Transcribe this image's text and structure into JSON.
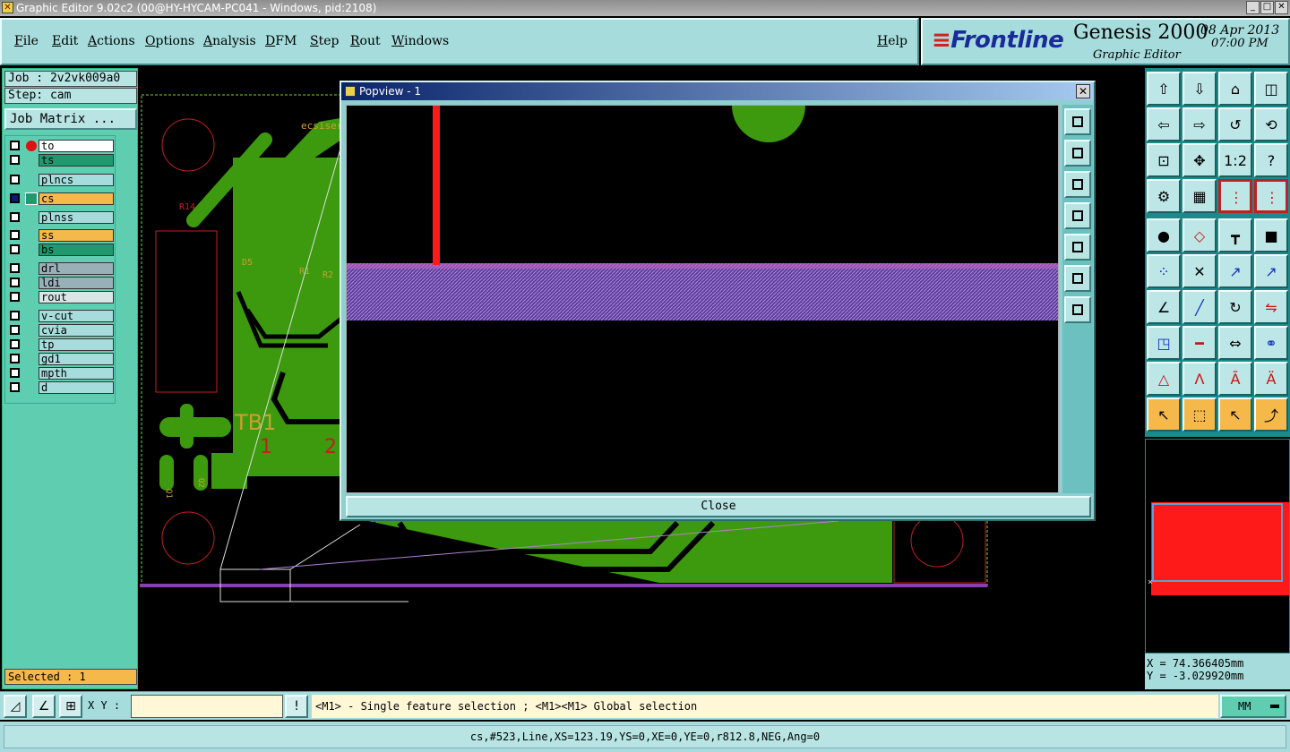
{
  "window": {
    "title": "Graphic Editor 9.02c2 (00@HY-HYCAM-PC041 - Windows, pid:2108)",
    "controls": [
      "_",
      "□",
      "✕"
    ]
  },
  "menu": [
    "File",
    "Edit",
    "Actions",
    "Options",
    "Analysis",
    "DFM",
    "Step",
    "Rout",
    "Windows"
  ],
  "help_label": "Help",
  "logo": {
    "brand": "Frontline",
    "product": "Genesis 2000",
    "subtitle": "Graphic Editor",
    "date": "08 Apr 2013",
    "time": "07:00 PM"
  },
  "job": {
    "job_label": "Job : 2v2vk009a0",
    "step_label": "Step: cam",
    "matrix_button": "Job Matrix ..."
  },
  "layers": [
    {
      "name": "to",
      "color": "#ffffff",
      "marker": "red-dot"
    },
    {
      "name": "ts",
      "color": "#1e9a6e",
      "marker": ""
    },
    {
      "name": "plncs",
      "color": "#a6dcdc",
      "marker": ""
    },
    {
      "name": "cs",
      "color": "#f5b84a",
      "marker": "work"
    },
    {
      "name": "plnss",
      "color": "#a6dcdc",
      "marker": ""
    },
    {
      "name": "ss",
      "color": "#f5b84a",
      "marker": ""
    },
    {
      "name": "bs",
      "color": "#1e9a6e",
      "marker": ""
    },
    {
      "name": "drl",
      "color": "#9ab0b8",
      "marker": ""
    },
    {
      "name": "ldi",
      "color": "#9ab0b8",
      "marker": ""
    },
    {
      "name": "rout",
      "color": "#d9e6e6",
      "marker": ""
    },
    {
      "name": "v-cut",
      "color": "#a6dcdc",
      "marker": ""
    },
    {
      "name": "cvia",
      "color": "#a6dcdc",
      "marker": ""
    },
    {
      "name": "tp",
      "color": "#a6dcdc",
      "marker": ""
    },
    {
      "name": "gd1",
      "color": "#a6dcdc",
      "marker": ""
    },
    {
      "name": "mpth",
      "color": "#a6dcdc",
      "marker": ""
    },
    {
      "name": "d",
      "color": "#a6dcdc",
      "marker": ""
    }
  ],
  "selected_label": "Selected : 1",
  "board_labels": {
    "r14": "R14",
    "d5": "D5",
    "r1": "R1",
    "r2": "R2",
    "tb1": "TB1",
    "tb1_pin1": "1",
    "tb1_pin2": "2",
    "silk": "ecsiser",
    "q1": "Q1",
    "q2": "Q2"
  },
  "popview": {
    "title": "Popview - 1",
    "close_label": "Close",
    "tools": [
      "zoom-window-icon",
      "pan-up-icon",
      "pan-down-icon",
      "pan-left-icon",
      "pan-right-icon",
      "zoom-in-icon",
      "zoom-out-icon"
    ]
  },
  "toolbox": [
    [
      "pan-up-icon",
      "pan-down-icon",
      "home-icon",
      "split-view-icon"
    ],
    [
      "pan-left-icon",
      "pan-right-icon",
      "undo-zoom-icon",
      "redraw-icon"
    ],
    [
      "zoom-fit-icon",
      "zoom-center-icon",
      "scale-icon",
      "help-icon"
    ],
    [
      "settings-icon",
      "grid-icon",
      "snap-icon",
      "snap-active-icon"
    ],
    [
      "add-pad-icon",
      "add-line-icon",
      "measure-icon",
      "add-surface-icon"
    ],
    [
      "connect-icon",
      "delete-icon",
      "move-icon",
      "copy-icon"
    ],
    [
      "draw-angle-icon",
      "draw-line-icon",
      "rotate-icon",
      "mirror-icon"
    ],
    [
      "resize-icon",
      "cut-line-icon",
      "stretch-icon",
      "merge-icon"
    ],
    [
      "route-icon",
      "route-add-icon",
      "route-edit-icon",
      "route-delete-icon"
    ],
    [
      "select-icon",
      "select-box-icon",
      "select-touch-icon",
      "select-net-icon"
    ]
  ],
  "coords": {
    "x": "X = 74.366405mm",
    "y": "Y = -3.029920mm"
  },
  "bottom": {
    "xy_label": "X Y :",
    "xy_value": "",
    "hint": "<M1> - Single feature selection ; <M1><M1> Global selection",
    "unit": "MM"
  },
  "status": "cs,#523,Line,XS=123.19,YS=0,XE=0,YE=0,r812.8,NEG,Ang=0",
  "colors": {
    "copper": "#3d9a0e",
    "outline": "#c02020",
    "selected": "#ff1a1a",
    "profile": "#8a3fb0",
    "panel": "#a6dcdc"
  }
}
